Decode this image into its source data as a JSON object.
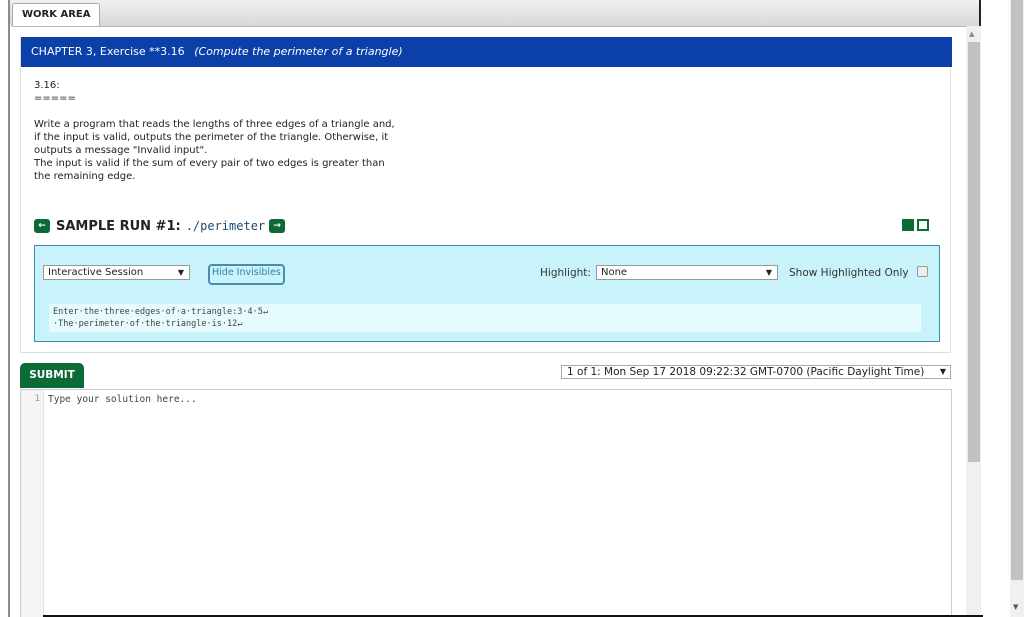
{
  "tab": {
    "label": "WORK AREA"
  },
  "chapter": {
    "title": "CHAPTER 3, Exercise **3.16",
    "subtitle": "(Compute the perimeter of a triangle)"
  },
  "description": {
    "number": "3.16:",
    "rule": "=====",
    "lines": [
      "Write a program that reads the lengths of three edges of a triangle and,",
      "if the input is valid, outputs the perimeter of the triangle. Otherwise, it",
      "outputs a message \"Invalid input\".",
      "The input is valid if the sum of every pair of two edges is greater than",
      "the remaining edge."
    ]
  },
  "sample_run": {
    "label": "SAMPLE RUN #1:",
    "command": "./perimeter",
    "prev_icon": "arrow-left-icon",
    "next_icon": "arrow-right-icon"
  },
  "session": {
    "mode_select": "Interactive Session",
    "hide_invisibles": "Hide Invisibles",
    "highlight_label": "Highlight:",
    "highlight_value": "None",
    "show_highlighted_only": "Show Highlighted Only",
    "show_highlighted_checked": false,
    "output_lines": [
      "Enter·the·three·edges·of·a·triangle:3·4·5↵",
      "·The·perimeter·of·the·triangle·is·12↵"
    ]
  },
  "submit": {
    "label": "SUBMIT"
  },
  "history": {
    "selected": "1 of 1: Mon Sep 17 2018 09:22:32 GMT-0700 (Pacific Daylight Time)"
  },
  "editor": {
    "line_number": "1",
    "placeholder": "Type your solution here..."
  },
  "colors": {
    "header_blue": "#0b40a8",
    "accent_green": "#0c6a35",
    "session_bg": "#c8f3fb"
  }
}
